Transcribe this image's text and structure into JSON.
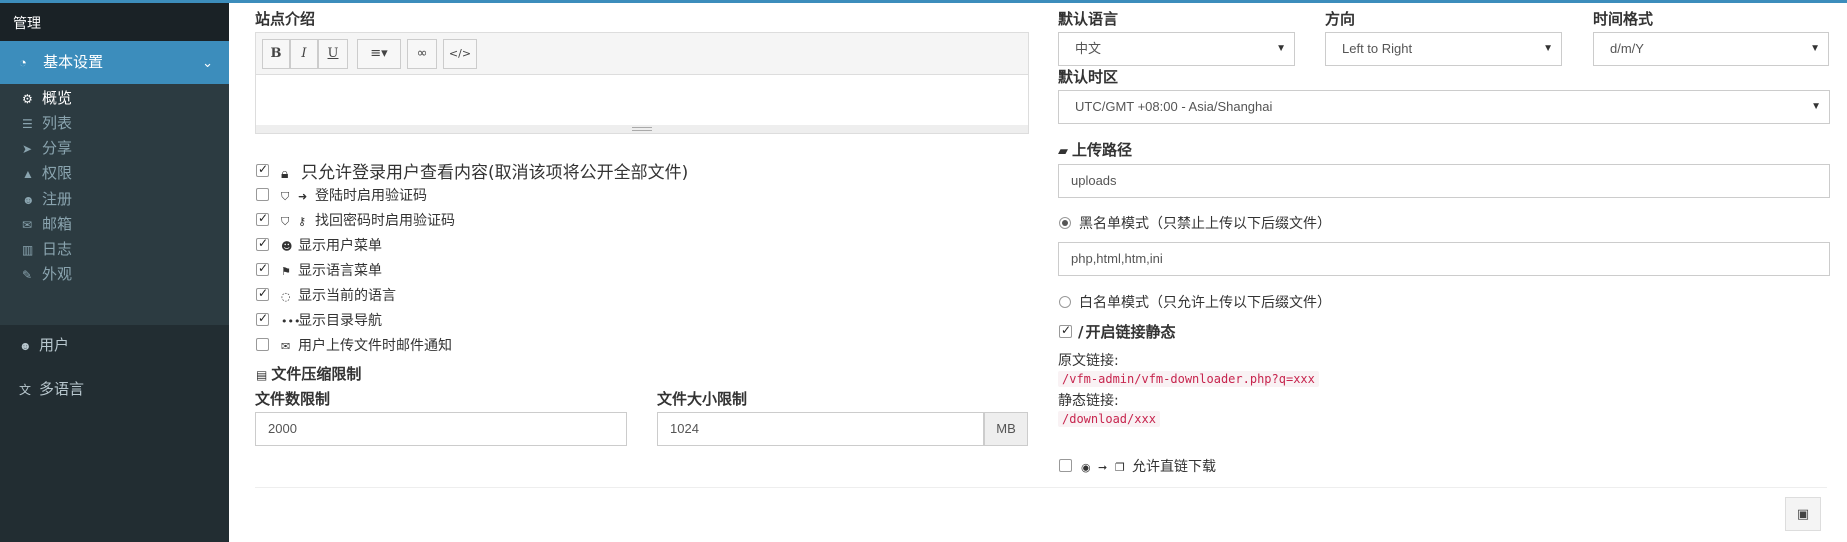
{
  "sidebar": {
    "header": "管理",
    "active": {
      "label": "基本设置",
      "icon": "dashboard-icon"
    },
    "sub_items": [
      {
        "label": "概览",
        "icon": "cogs-icon",
        "current": true
      },
      {
        "label": "列表",
        "icon": "list-icon"
      },
      {
        "label": "分享",
        "icon": "paper-plane-icon"
      },
      {
        "label": "权限",
        "icon": "graduation-cap-icon"
      },
      {
        "label": "注册",
        "icon": "user-plus-icon"
      },
      {
        "label": "邮箱",
        "icon": "envelope-icon"
      },
      {
        "label": "日志",
        "icon": "bar-chart-icon"
      },
      {
        "label": "外观",
        "icon": "paint-brush-icon"
      }
    ],
    "items": [
      {
        "label": "用户",
        "icon": "users-icon"
      },
      {
        "label": "多语言",
        "icon": "language-icon"
      }
    ]
  },
  "site_intro": {
    "label": "站点介绍",
    "toolbar": {
      "bold": "B",
      "italic": "I",
      "underline": "U"
    }
  },
  "options": [
    {
      "label": "只允许登录用户查看内容(取消该项将公开全部文件)",
      "checked": true,
      "icon": "lock-icon"
    },
    {
      "label": "登陆时启用验证码",
      "checked": false,
      "icon": "shield-icon"
    },
    {
      "label": "找回密码时启用验证码",
      "checked": true,
      "icon": "shield-icon"
    },
    {
      "label": "显示用户菜单",
      "checked": true,
      "icon": "user-icon"
    },
    {
      "label": "显示语言菜单",
      "checked": true,
      "icon": "flag-icon"
    },
    {
      "label": "显示当前的语言",
      "checked": true,
      "icon": "comment-icon"
    },
    {
      "label": "显示目录导航",
      "checked": true,
      "icon": "ellipsis-icon"
    },
    {
      "label": "用户上传文件时邮件通知",
      "checked": false,
      "icon": "envelope-icon"
    }
  ],
  "compress": {
    "title": "文件压缩限制",
    "count_label": "文件数限制",
    "count_value": "2000",
    "size_label": "文件大小限制",
    "size_value": "1024",
    "size_unit": "MB"
  },
  "language": {
    "label": "默认语言",
    "value": "中文"
  },
  "direction": {
    "label": "方向",
    "value": "Left to Right"
  },
  "time_format": {
    "label": "时间格式",
    "value": "d/m/Y"
  },
  "timezone": {
    "label": "默认时区",
    "value": "UTC/GMT +08:00 - Asia/Shanghai"
  },
  "upload": {
    "label": "上传路径",
    "value": "uploads",
    "blacklist_label": "黑名单模式（只禁止上传以下后缀文件）",
    "blacklist_value": "php,html,htm,ini",
    "blacklist_selected": true,
    "whitelist_label": "白名单模式（只允许上传以下后缀文件）",
    "whitelist_selected": false
  },
  "permalink": {
    "label": "开启链接静态",
    "checked": true,
    "orig_label": "原文链接:",
    "orig_value": "/vfm-admin/vfm-downloader.php?q=xxx",
    "static_label": "静态链接:",
    "static_value": "/download/xxx"
  },
  "direct_link": {
    "label": "允许直链下载",
    "checked": false
  },
  "colors": {
    "primary": "#3c8dbc",
    "sidebar": "#222d32",
    "code": "#c7254e"
  }
}
